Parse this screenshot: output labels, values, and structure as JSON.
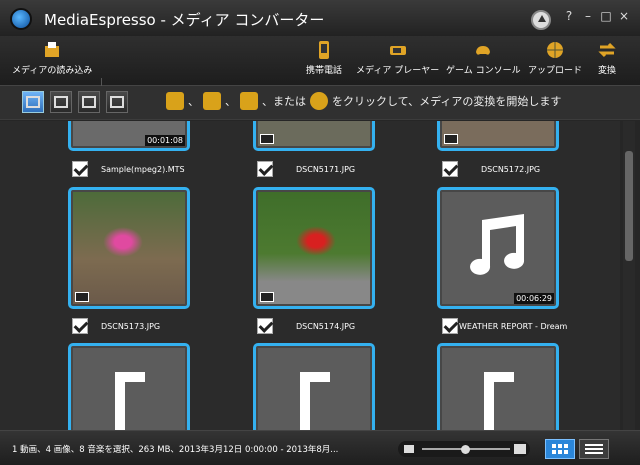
{
  "window": {
    "title": "MediaEspresso  - メディア コンバーター",
    "help": "?",
    "minimize": "–",
    "maximize": "□",
    "close": "×"
  },
  "toolbar": {
    "import": "メディアの読み込み",
    "mobile": "携帯電話",
    "media_player": "メディア プレーヤー",
    "game_console": "ゲーム コンソール",
    "upload": "アップロード",
    "convert": "変換"
  },
  "filterbar": {
    "hint": "、 または をクリックして、メディアの変換を開始します",
    "sep1": "、",
    "sep2": "、",
    "or": "、または"
  },
  "items": [
    {
      "name": "Sample(mpeg2).MTS",
      "duration": "00:01:08",
      "checked": true
    },
    {
      "name": "DSCN5171.JPG",
      "duration": "",
      "checked": true
    },
    {
      "name": "DSCN5172.JPG",
      "duration": "",
      "checked": true
    },
    {
      "name": "DSCN5173.JPG",
      "duration": "",
      "checked": true
    },
    {
      "name": "DSCN5174.JPG",
      "duration": "",
      "checked": true
    },
    {
      "name": "WEATHER REPORT - Dream",
      "duration": "00:06:29",
      "checked": true
    }
  ],
  "status": {
    "text": "1 動画、4 画像、8 音楽を選択、263 MB、2013年3月12日 0:00:00 - 2013年8月..."
  },
  "colors": {
    "accent": "#34b1f0",
    "toolbar_bg": "#262626"
  },
  "zoom_level": 0.5
}
